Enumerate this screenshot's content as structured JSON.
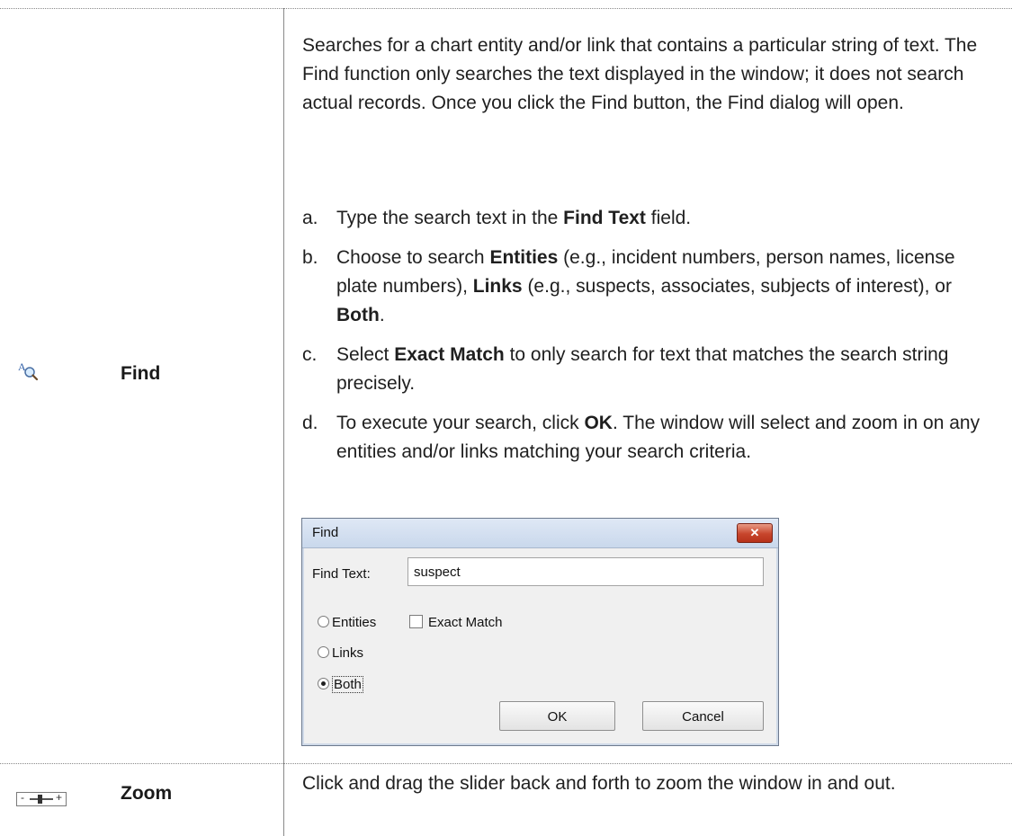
{
  "find_row": {
    "icon": "find-text-icon",
    "name": "Find",
    "description": "Searches for a chart entity and/or link that contains a particular string of text. The Find function only searches the text displayed in the window; it does not search actual records. Once you click the Find button, the Find dialog will open.",
    "steps": [
      {
        "letter": "a.",
        "parts": [
          "Type the search text in the ",
          "Find Text",
          " field."
        ]
      },
      {
        "letter": "b.",
        "parts": [
          "Choose to search ",
          "Entities",
          " (e.g., incident numbers, person names, license plate numbers), ",
          "Links",
          " (e.g., suspects, associates, subjects of interest), or ",
          "Both",
          "."
        ]
      },
      {
        "letter": "c.",
        "parts": [
          "Select ",
          "Exact Match",
          " to only search for text that matches the search string precisely."
        ]
      },
      {
        "letter": "d.",
        "parts": [
          "To execute your search, click ",
          "OK",
          ". The window will select and zoom in on any entities and/or links matching your search criteria."
        ]
      }
    ]
  },
  "dialog": {
    "title": "Find",
    "close_glyph": "✕",
    "find_text_label": "Find Text:",
    "find_text_value": "suspect",
    "radio_entities": "Entities",
    "radio_links": "Links",
    "radio_both": "Both",
    "selected_radio": "Both",
    "exact_match_label": "Exact Match",
    "exact_match_checked": false,
    "ok_label": "OK",
    "cancel_label": "Cancel"
  },
  "zoom_row": {
    "icon": "zoom-slider-icon",
    "slider_minus": "-",
    "slider_plus": "+",
    "name": "Zoom",
    "description": "Click and drag the slider back and forth to zoom the window in and out."
  },
  "colors": {
    "rule": "#8a8a8a",
    "close_button": "#c7452c",
    "dialog_bg": "#f0f0f0"
  }
}
